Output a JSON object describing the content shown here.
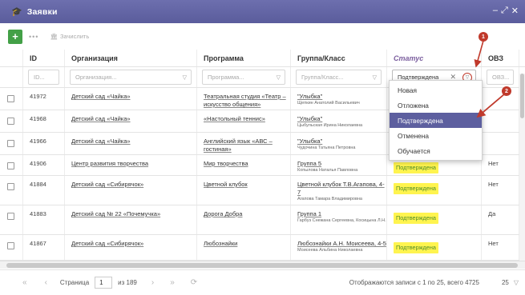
{
  "window": {
    "title": "Заявки",
    "controls": [
      "–",
      "⤢",
      "✕"
    ]
  },
  "toolbar": {
    "add_label": "+",
    "more_label": "•••",
    "calc_label": "Зачислить"
  },
  "columns": [
    {
      "key": "id",
      "label": "ID",
      "filter_placeholder": "ID..."
    },
    {
      "key": "org",
      "label": "Организация",
      "filter_placeholder": "Организация..."
    },
    {
      "key": "prog",
      "label": "Программа",
      "filter_placeholder": "Программа..."
    },
    {
      "key": "group",
      "label": "Группа/Класс",
      "filter_placeholder": "Группа/Класс..."
    },
    {
      "key": "status",
      "label": "Статус",
      "filter_value": "Подтверждена"
    },
    {
      "key": "ovz",
      "label": "ОВЗ",
      "filter_placeholder": "ОВЗ..."
    }
  ],
  "rows": [
    {
      "id": "41972",
      "org": "Детский сад «Чайка»",
      "prog": "Театральная студия «Театр – искусство общения»",
      "group": "\"Улыбка\"",
      "group_sub": "Щепкин Анатолий Васильевич",
      "status": "",
      "ovz": ""
    },
    {
      "id": "41968",
      "org": "Детский сад «Чайка»",
      "prog": "«Настольный теннис»",
      "group": "\"Улыбка\"",
      "group_sub": "Цыбульская Ирина Николаевна",
      "status": "",
      "ovz": ""
    },
    {
      "id": "41966",
      "org": "Детский сад «Чайка»",
      "prog": "Английский язык «АВС – гостиная»",
      "group": "\"Улыбка\"",
      "group_sub": "Чудочина Татьяна Петровна",
      "status": "",
      "ovz": ""
    },
    {
      "id": "41906",
      "org": "Центр развития творчества",
      "prog": "Мир творчества",
      "group": "Группа 5",
      "group_sub": "Копылова Наталья Павловна",
      "status": "Подтверждена",
      "ovz": "Нет"
    },
    {
      "id": "41884",
      "org": "Детский сад «Сибирячок»",
      "prog": "Цветной клубок",
      "group": "Цветной клубок Т.В.Агапова, 4-7",
      "group_sub": "Агапова Тамара Владимировна",
      "status": "Подтверждена",
      "ovz": "Нет"
    },
    {
      "id": "41883",
      "org": "Детский сад № 22 «Почемучка»",
      "prog": "Дорога Добра",
      "group": "Группа 1",
      "group_sub": "Гарбуз Снежана Сергеевна, Косицына Л.Н.",
      "status": "Подтверждена",
      "ovz": "Да"
    },
    {
      "id": "41867",
      "org": "Детский сад «Сибирячок»",
      "prog": "Любознайки",
      "group": "Любознайки А.Н. Моисеева, 4-5",
      "group_sub": "Моисеева Альбина Николаевна",
      "status": "Подтверждена",
      "ovz": "Нет"
    }
  ],
  "dropdown": {
    "options": [
      "Новая",
      "Отложена",
      "Подтверждена",
      "Отменена",
      "Обучается"
    ],
    "selected": "Подтверждена"
  },
  "markers": {
    "m1": "1",
    "m2": "2"
  },
  "pager": {
    "page_label": "Страница",
    "page_value": "1",
    "of_label": "из 189",
    "summary": "Отображаются записи с 1 по 25, всего 4725",
    "page_size": "25"
  },
  "colors": {
    "titlebar": "#5a5c9c",
    "selected_option": "#5d5f9f",
    "badge_bg": "#fff44f",
    "badge_text": "#4a8a2a",
    "marker": "#c0392b",
    "add_button": "#43a047"
  }
}
